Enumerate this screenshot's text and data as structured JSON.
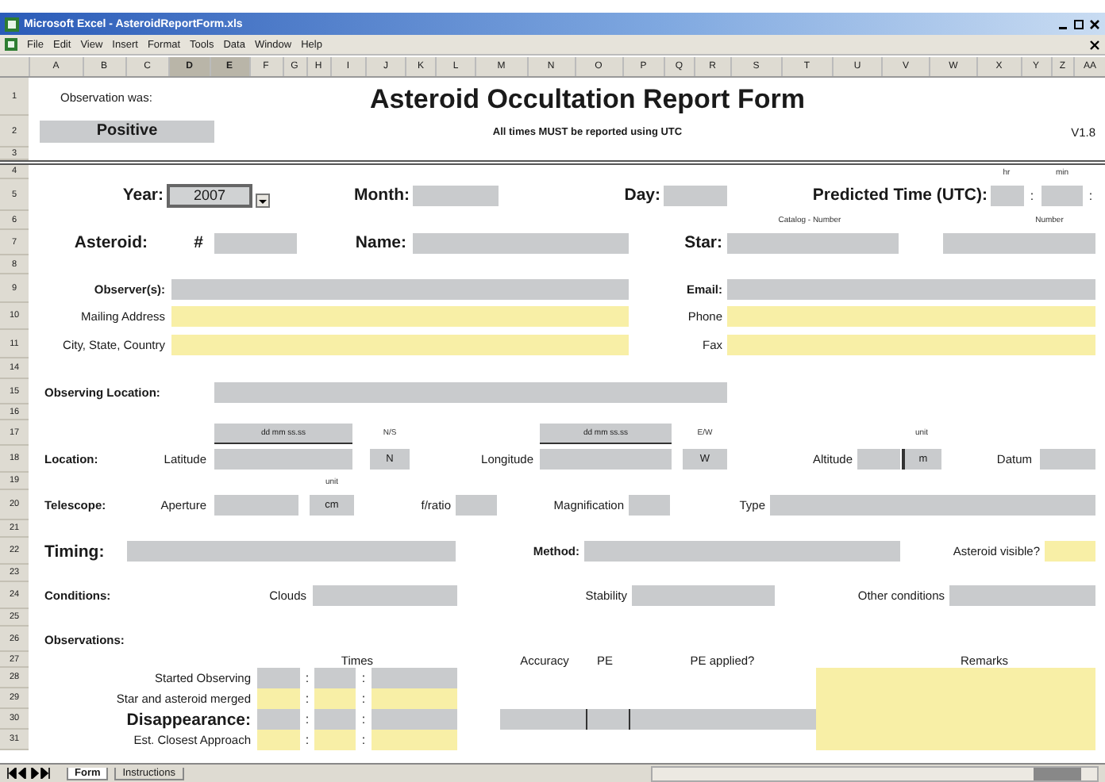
{
  "window": {
    "title": "Microsoft Excel - AsteroidReportForm.xls"
  },
  "menu": [
    "File",
    "Edit",
    "View",
    "Insert",
    "Format",
    "Tools",
    "Data",
    "Window",
    "Help"
  ],
  "columns": [
    {
      "label": "A",
      "selected": false
    },
    {
      "label": "B",
      "selected": false
    },
    {
      "label": "C",
      "selected": false
    },
    {
      "label": "D",
      "selected": true
    },
    {
      "label": "E",
      "selected": true
    },
    {
      "label": "F",
      "selected": false
    },
    {
      "label": "G",
      "selected": false
    },
    {
      "label": "H",
      "selected": false
    },
    {
      "label": "I",
      "selected": false
    },
    {
      "label": "J",
      "selected": false
    },
    {
      "label": "K",
      "selected": false
    },
    {
      "label": "L",
      "selected": false
    },
    {
      "label": "M",
      "selected": false
    },
    {
      "label": "N",
      "selected": false
    },
    {
      "label": "O",
      "selected": false
    },
    {
      "label": "P",
      "selected": false
    },
    {
      "label": "Q",
      "selected": false
    },
    {
      "label": "R",
      "selected": false
    },
    {
      "label": "S",
      "selected": false
    },
    {
      "label": "T",
      "selected": false
    },
    {
      "label": "U",
      "selected": false
    },
    {
      "label": "V",
      "selected": false
    },
    {
      "label": "W",
      "selected": false
    },
    {
      "label": "X",
      "selected": false
    },
    {
      "label": "Y",
      "selected": false
    },
    {
      "label": "Z",
      "selected": false
    },
    {
      "label": "AA",
      "selected": false
    }
  ],
  "rows": [
    {
      "number": "1",
      "cells": [
        {
          "kind": "label",
          "text": "Observation was:"
        },
        {
          "kind": "title",
          "text": "Asteroid Occultation Report Form"
        }
      ]
    },
    {
      "number": "2",
      "cells": [
        {
          "kind": "status",
          "text": "Positive"
        },
        {
          "kind": "subtitle",
          "text": "All times MUST be reported using UTC"
        },
        {
          "kind": "label",
          "text": "V1.8"
        }
      ]
    },
    {
      "number": "3",
      "cells": []
    },
    {
      "number": "4",
      "cells": [
        {
          "kind": "note",
          "text": "hr"
        },
        {
          "kind": "note",
          "text": "min"
        }
      ]
    },
    {
      "number": "5",
      "cells": [
        {
          "kind": "heading",
          "text": "Year:"
        },
        {
          "kind": "combo",
          "value": "2007"
        },
        {
          "kind": "heading",
          "text": "Month:"
        },
        {
          "kind": "field",
          "highlighted": false
        },
        {
          "kind": "heading",
          "text": "Day:"
        },
        {
          "kind": "field",
          "highlighted": false
        },
        {
          "kind": "heading",
          "text": "Predicted Time (UTC):"
        },
        {
          "kind": "field",
          "highlighted": false
        },
        {
          "kind": "sep",
          "text": ":"
        },
        {
          "kind": "field",
          "highlighted": false
        },
        {
          "kind": "sep",
          "text": ":"
        }
      ]
    },
    {
      "number": "6",
      "cells": [
        {
          "kind": "note",
          "text": "Catalog - Number"
        },
        {
          "kind": "note",
          "text": "Number"
        }
      ]
    },
    {
      "number": "7",
      "cells": [
        {
          "kind": "heading",
          "text": "Asteroid:"
        },
        {
          "kind": "heading",
          "text": "#"
        },
        {
          "kind": "field",
          "highlighted": false
        },
        {
          "kind": "heading",
          "text": "Name:"
        },
        {
          "kind": "field",
          "highlighted": false
        },
        {
          "kind": "heading",
          "text": "Star:"
        },
        {
          "kind": "field",
          "highlighted": false
        },
        {
          "kind": "field",
          "highlighted": false
        }
      ]
    },
    {
      "number": "8",
      "cells": []
    },
    {
      "number": "9",
      "cells": [
        {
          "kind": "label-bold",
          "text": "Observer(s):"
        },
        {
          "kind": "field",
          "highlighted": false
        },
        {
          "kind": "label-bold",
          "text": "Email:"
        },
        {
          "kind": "field",
          "highlighted": false
        }
      ]
    },
    {
      "number": "10",
      "cells": [
        {
          "kind": "label",
          "text": "Mailing Address"
        },
        {
          "kind": "field",
          "highlighted": true
        },
        {
          "kind": "label",
          "text": "Phone"
        },
        {
          "kind": "field",
          "highlighted": true
        }
      ]
    },
    {
      "number": "11",
      "cells": [
        {
          "kind": "label",
          "text": "City, State, Country"
        },
        {
          "kind": "field",
          "highlighted": true
        },
        {
          "kind": "label",
          "text": "Fax"
        },
        {
          "kind": "field",
          "highlighted": true
        }
      ]
    },
    {
      "number": "14",
      "cells": []
    },
    {
      "number": "15",
      "cells": [
        {
          "kind": "label-bold",
          "text": "Observing Location:"
        },
        {
          "kind": "field",
          "highlighted": false
        }
      ]
    },
    {
      "number": "16",
      "cells": []
    },
    {
      "number": "17",
      "cells": [
        {
          "kind": "hint",
          "text": "dd mm ss.ss"
        },
        {
          "kind": "note",
          "text": "N/S"
        },
        {
          "kind": "hint",
          "text": "dd mm ss.ss"
        },
        {
          "kind": "note",
          "text": "E/W"
        },
        {
          "kind": "note",
          "text": "unit"
        }
      ]
    },
    {
      "number": "18",
      "cells": [
        {
          "kind": "label-bold",
          "text": "Location:"
        },
        {
          "kind": "label",
          "text": "Latitude"
        },
        {
          "kind": "field",
          "highlighted": false
        },
        {
          "kind": "field",
          "highlighted": false,
          "value": "N"
        },
        {
          "kind": "label",
          "text": "Longitude"
        },
        {
          "kind": "field",
          "highlighted": false
        },
        {
          "kind": "field",
          "highlighted": false,
          "value": "W"
        },
        {
          "kind": "label",
          "text": "Altitude"
        },
        {
          "kind": "field",
          "highlighted": false
        },
        {
          "kind": "field",
          "highlighted": false,
          "value": "m"
        },
        {
          "kind": "label",
          "text": "Datum"
        },
        {
          "kind": "field",
          "highlighted": false
        }
      ]
    },
    {
      "number": "19",
      "cells": [
        {
          "kind": "note",
          "text": "unit"
        }
      ]
    },
    {
      "number": "20",
      "cells": [
        {
          "kind": "label-bold",
          "text": "Telescope:"
        },
        {
          "kind": "label",
          "text": "Aperture"
        },
        {
          "kind": "field",
          "highlighted": false
        },
        {
          "kind": "field",
          "highlighted": false,
          "value": "cm"
        },
        {
          "kind": "label",
          "text": "f/ratio"
        },
        {
          "kind": "field",
          "highlighted": false
        },
        {
          "kind": "label",
          "text": "Magnification"
        },
        {
          "kind": "field",
          "highlighted": false
        },
        {
          "kind": "label",
          "text": "Type"
        },
        {
          "kind": "field",
          "highlighted": false
        }
      ]
    },
    {
      "number": "21",
      "cells": []
    },
    {
      "number": "22",
      "cells": [
        {
          "kind": "heading",
          "text": "Timing:"
        },
        {
          "kind": "field",
          "highlighted": false
        },
        {
          "kind": "label-bold",
          "text": "Method:"
        },
        {
          "kind": "field",
          "highlighted": false
        },
        {
          "kind": "label",
          "text": "Asteroid visible?"
        },
        {
          "kind": "field",
          "highlighted": true
        }
      ]
    },
    {
      "number": "23",
      "cells": []
    },
    {
      "number": "24",
      "cells": [
        {
          "kind": "label-bold",
          "text": "Conditions:"
        },
        {
          "kind": "label",
          "text": "Clouds"
        },
        {
          "kind": "field",
          "highlighted": false
        },
        {
          "kind": "label",
          "text": "Stability"
        },
        {
          "kind": "field",
          "highlighted": false
        },
        {
          "kind": "label",
          "text": "Other conditions"
        },
        {
          "kind": "field",
          "highlighted": false
        }
      ]
    },
    {
      "number": "25",
      "cells": []
    },
    {
      "number": "26",
      "cells": [
        {
          "kind": "label-bold",
          "text": "Observations:"
        }
      ]
    },
    {
      "number": "27",
      "cells": [
        {
          "kind": "label",
          "text": "Times"
        },
        {
          "kind": "label",
          "text": "Accuracy"
        },
        {
          "kind": "label",
          "text": "PE"
        },
        {
          "kind": "label",
          "text": "PE applied?"
        },
        {
          "kind": "label",
          "text": "Remarks"
        }
      ]
    },
    {
      "number": "28",
      "cells": [
        {
          "kind": "label",
          "text": "Started Observing"
        },
        {
          "kind": "field",
          "highlighted": false
        },
        {
          "kind": "sep",
          "text": ":"
        },
        {
          "kind": "field",
          "highlighted": false
        },
        {
          "kind": "sep",
          "text": ":"
        },
        {
          "kind": "field",
          "highlighted": false
        },
        {
          "kind": "field",
          "highlighted": true
        }
      ]
    },
    {
      "number": "29",
      "cells": [
        {
          "kind": "label",
          "text": "Star and asteroid merged"
        },
        {
          "kind": "field",
          "highlighted": true
        },
        {
          "kind": "sep",
          "text": ":"
        },
        {
          "kind": "field",
          "highlighted": true
        },
        {
          "kind": "sep",
          "text": ":"
        },
        {
          "kind": "field",
          "highlighted": true
        },
        {
          "kind": "field",
          "highlighted": true
        }
      ]
    },
    {
      "number": "30",
      "cells": [
        {
          "kind": "heading",
          "text": "Disappearance:"
        },
        {
          "kind": "field",
          "highlighted": false
        },
        {
          "kind": "sep",
          "text": ":"
        },
        {
          "kind": "field",
          "highlighted": false
        },
        {
          "kind": "sep",
          "text": ":"
        },
        {
          "kind": "field",
          "highlighted": false
        },
        {
          "kind": "field",
          "highlighted": false
        },
        {
          "kind": "field",
          "highlighted": false
        },
        {
          "kind": "fill"
        },
        {
          "kind": "field",
          "highlighted": true
        }
      ]
    },
    {
      "number": "31",
      "cells": [
        {
          "kind": "label",
          "text": "Est. Closest Approach"
        },
        {
          "kind": "field",
          "highlighted": true
        },
        {
          "kind": "sep",
          "text": ":"
        },
        {
          "kind": "field",
          "highlighted": true
        },
        {
          "kind": "sep",
          "text": ":"
        },
        {
          "kind": "field",
          "highlighted": true
        },
        {
          "kind": "field",
          "highlighted": true
        }
      ]
    }
  ],
  "sheet_tabs": [
    {
      "label": "Form",
      "selected": true
    },
    {
      "label": "Instructions",
      "selected": false
    }
  ]
}
